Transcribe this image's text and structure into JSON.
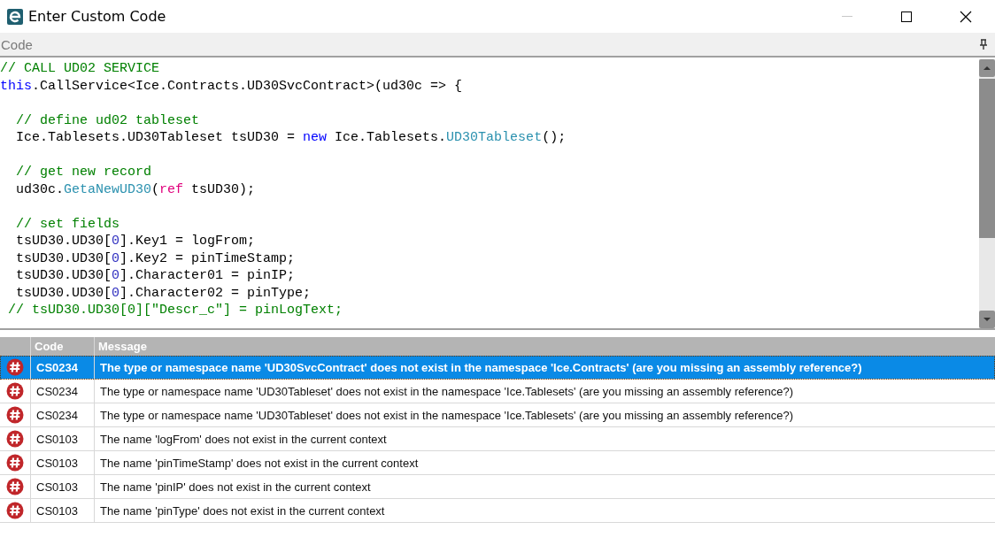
{
  "window": {
    "title": "Enter Custom Code"
  },
  "panel": {
    "title": "Code"
  },
  "code_lines": [
    {
      "kind": "code",
      "tokens": [
        {
          "kind": "comment",
          "text": "// CALL UD02 SERVICE"
        }
      ]
    },
    {
      "kind": "code",
      "tokens": [
        {
          "kind": "keyword",
          "text": "this"
        },
        {
          "kind": "plain",
          "text": ".CallService<Ice.Contracts.UD30SvcContract>(ud30c => {"
        }
      ]
    },
    {
      "kind": "blank"
    },
    {
      "kind": "code",
      "tokens": [
        {
          "kind": "comment",
          "text": "  // define ud02 tableset"
        }
      ]
    },
    {
      "kind": "code",
      "tokens": [
        {
          "kind": "plain",
          "text": "  Ice.Tablesets.UD30Tableset tsUD30 = "
        },
        {
          "kind": "keyword",
          "text": "new"
        },
        {
          "kind": "plain",
          "text": " Ice.Tablesets."
        },
        {
          "kind": "type",
          "text": "UD30Tableset"
        },
        {
          "kind": "plain",
          "text": "();"
        }
      ]
    },
    {
      "kind": "blank"
    },
    {
      "kind": "code",
      "tokens": [
        {
          "kind": "comment",
          "text": "  // get new record"
        }
      ]
    },
    {
      "kind": "code",
      "tokens": [
        {
          "kind": "plain",
          "text": "  ud30c."
        },
        {
          "kind": "type",
          "text": "GetaNewUD30"
        },
        {
          "kind": "plain",
          "text": "("
        },
        {
          "kind": "ref",
          "text": "ref"
        },
        {
          "kind": "plain",
          "text": " tsUD30);"
        }
      ]
    },
    {
      "kind": "blank"
    },
    {
      "kind": "code",
      "tokens": [
        {
          "kind": "comment",
          "text": "  // set fields"
        }
      ]
    },
    {
      "kind": "code",
      "tokens": [
        {
          "kind": "plain",
          "text": "  tsUD30.UD30["
        },
        {
          "kind": "number",
          "text": "0"
        },
        {
          "kind": "plain",
          "text": "].Key1 = logFrom;"
        }
      ]
    },
    {
      "kind": "code",
      "tokens": [
        {
          "kind": "plain",
          "text": "  tsUD30.UD30["
        },
        {
          "kind": "number",
          "text": "0"
        },
        {
          "kind": "plain",
          "text": "].Key2 = pinTimeStamp;"
        }
      ]
    },
    {
      "kind": "code",
      "tokens": [
        {
          "kind": "plain",
          "text": "  tsUD30.UD30["
        },
        {
          "kind": "number",
          "text": "0"
        },
        {
          "kind": "plain",
          "text": "].Character01 = pinIP;"
        }
      ]
    },
    {
      "kind": "code",
      "tokens": [
        {
          "kind": "plain",
          "text": "  tsUD30.UD30["
        },
        {
          "kind": "number",
          "text": "0"
        },
        {
          "kind": "plain",
          "text": "].Character02 = pinType;"
        }
      ]
    },
    {
      "kind": "code",
      "tokens": [
        {
          "kind": "comment",
          "text": " // tsUD30.UD30[0][\"Descr_c\"] = pinLogText;"
        }
      ]
    }
  ],
  "errors": {
    "columns": [
      "Code",
      "Message"
    ],
    "rows": [
      {
        "code": "CS0234",
        "message": "The type or namespace name 'UD30SvcContract' does not exist in the namespace 'Ice.Contracts' (are you missing an assembly reference?)",
        "selected": true
      },
      {
        "code": "CS0234",
        "message": "The type or namespace name 'UD30Tableset' does not exist in the namespace 'Ice.Tablesets' (are you missing an assembly reference?)",
        "selected": false
      },
      {
        "code": "CS0234",
        "message": "The type or namespace name 'UD30Tableset' does not exist in the namespace 'Ice.Tablesets' (are you missing an assembly reference?)",
        "selected": false
      },
      {
        "code": "CS0103",
        "message": "The name 'logFrom' does not exist in the current context",
        "selected": false
      },
      {
        "code": "CS0103",
        "message": "The name 'pinTimeStamp' does not exist in the current context",
        "selected": false
      },
      {
        "code": "CS0103",
        "message": "The name 'pinIP' does not exist in the current context",
        "selected": false
      },
      {
        "code": "CS0103",
        "message": "The name 'pinType' does not exist in the current context",
        "selected": false
      }
    ]
  }
}
